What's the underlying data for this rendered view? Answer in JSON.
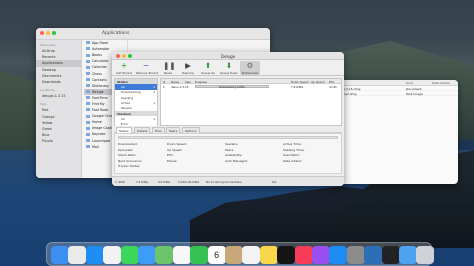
{
  "finder": {
    "title": "Applications",
    "sidebar_sections": [
      {
        "title": "Favourites",
        "items": [
          {
            "label": "AirDrop",
            "selected": false
          },
          {
            "label": "Recents",
            "selected": false
          },
          {
            "label": "Applications",
            "selected": true
          },
          {
            "label": "Desktop",
            "selected": false
          },
          {
            "label": "Documents",
            "selected": false
          },
          {
            "label": "Downloads",
            "selected": false
          }
        ]
      },
      {
        "title": "Locations",
        "items": [
          {
            "label": "deluge-1.3.15",
            "selected": false
          }
        ]
      },
      {
        "title": "Tags",
        "items": [
          {
            "label": "Red",
            "selected": false
          },
          {
            "label": "Orange",
            "selected": false
          },
          {
            "label": "Yellow",
            "selected": false
          },
          {
            "label": "Green",
            "selected": false
          },
          {
            "label": "Blue",
            "selected": false
          },
          {
            "label": "Purple",
            "selected": false
          }
        ]
      }
    ],
    "apps": [
      "App Store",
      "Automator",
      "Books",
      "Calculator",
      "Calendar",
      "Chess",
      "Contacts",
      "Dictionary",
      "Deluge",
      "FaceTime",
      "Find My",
      "Font Book",
      "Google Chrome",
      "Home",
      "Image Capture",
      "Keynote",
      "Launchpad",
      "Mail"
    ],
    "selected_app": "Deluge"
  },
  "downloads": {
    "columns": [
      "Kind",
      "Date Added"
    ],
    "rows": [
      {
        "name": "...deluge-1.3.15.dmg",
        "kind": "Document",
        "date": ""
      },
      {
        "name": "...-1.3.15-osx.dmg",
        "kind": "Disk Image",
        "date": ""
      }
    ]
  },
  "deluge": {
    "title": "Deluge",
    "toolbar": [
      {
        "label": "Add Torrent",
        "icon": "plus-icon"
      },
      {
        "label": "Remove Torrent",
        "icon": "minus-icon"
      },
      {
        "label": "Pause",
        "icon": "pause-icon"
      },
      {
        "label": "Resume",
        "icon": "play-icon"
      },
      {
        "label": "Queue Up",
        "icon": "arrow-up-icon"
      },
      {
        "label": "Queue Down",
        "icon": "arrow-down-icon"
      },
      {
        "label": "Preferences",
        "icon": "gear-icon"
      }
    ],
    "filters": {
      "states_header": "States",
      "states": [
        {
          "label": "All",
          "count": "1",
          "selected": true
        },
        {
          "label": "Downloading",
          "count": "1",
          "selected": false
        },
        {
          "label": "Seeding",
          "count": "",
          "selected": false
        },
        {
          "label": "Active",
          "count": "1",
          "selected": false
        },
        {
          "label": "Paused",
          "count": "",
          "selected": false
        }
      ],
      "trackers_header": "Trackers",
      "trackers": [
        {
          "label": "All",
          "count": "1",
          "selected": false
        },
        {
          "label": "Error",
          "count": "",
          "selected": false
        },
        {
          "label": "tracker.com",
          "count": "1",
          "selected": false
        }
      ]
    },
    "columns": [
      "#",
      "Name",
      "Size",
      "Progress",
      "Down Speed",
      "Up Speed",
      "ETA"
    ],
    "torrents": [
      {
        "num": "1",
        "name": "deluv-1.3.15",
        "size": "",
        "progress": 0.0,
        "progress_text": "Downloading 0.00%",
        "down_speed": "7.6 KiB/s",
        "up_speed": "",
        "eta": "4d 4h"
      }
    ],
    "tabs": [
      "Status",
      "Details",
      "Files",
      "Peers",
      "Options"
    ],
    "status_fields": [
      [
        "Downloaded:",
        "Down Speed:",
        "Seeders:",
        "Active Time:"
      ],
      [
        "Uploaded:",
        "Up Speed:",
        "Peers:",
        "Seeding Time:"
      ],
      [
        "Share Ratio:",
        "ETA:",
        "Availability:",
        "Seed Rank:"
      ],
      [
        "Next Announce:",
        "Pieces:",
        "Auto Managed:",
        "Date Added:"
      ],
      [
        "Tracker Status:",
        "",
        "",
        ""
      ]
    ],
    "statusbar": [
      "1 (200)",
      "7.6 KiB/s",
      "0.0 KiB/s",
      "0.00/0.00 KiB/s",
      "No Incoming Connections",
      "0/1"
    ]
  },
  "dock": {
    "icons": [
      {
        "name": "finder-icon",
        "color": "#3a8ff1"
      },
      {
        "name": "launchpad-icon",
        "color": "#eaeaea"
      },
      {
        "name": "safari-icon",
        "color": "#1e8ef5"
      },
      {
        "name": "chrome-icon",
        "color": "#f2f2f2"
      },
      {
        "name": "messages-icon",
        "color": "#3cd75a"
      },
      {
        "name": "mail-icon",
        "color": "#3d9cf5"
      },
      {
        "name": "maps-icon",
        "color": "#6cc56a"
      },
      {
        "name": "photos-icon",
        "color": "#f7f7f7"
      },
      {
        "name": "facetime-icon",
        "color": "#35c252"
      },
      {
        "name": "calendar-icon",
        "color": "#ffffff"
      },
      {
        "name": "contacts-icon",
        "color": "#c8a778"
      },
      {
        "name": "reminders-icon",
        "color": "#f3f3f3"
      },
      {
        "name": "notes-icon",
        "color": "#f8d74b"
      },
      {
        "name": "tv-icon",
        "color": "#141414"
      },
      {
        "name": "music-icon",
        "color": "#f93c57"
      },
      {
        "name": "podcasts-icon",
        "color": "#9b4ff0"
      },
      {
        "name": "appstore-icon",
        "color": "#1d8cf3"
      },
      {
        "name": "settings-icon",
        "color": "#8c8c8c"
      },
      {
        "name": "deluge-icon",
        "color": "#2d6fb7"
      },
      {
        "name": "terminal-icon",
        "color": "#222222"
      },
      {
        "name": "folder-icon",
        "color": "#4ea3f1"
      },
      {
        "name": "trash-icon",
        "color": "#cfd3d8"
      }
    ],
    "calendar_day": "6"
  }
}
